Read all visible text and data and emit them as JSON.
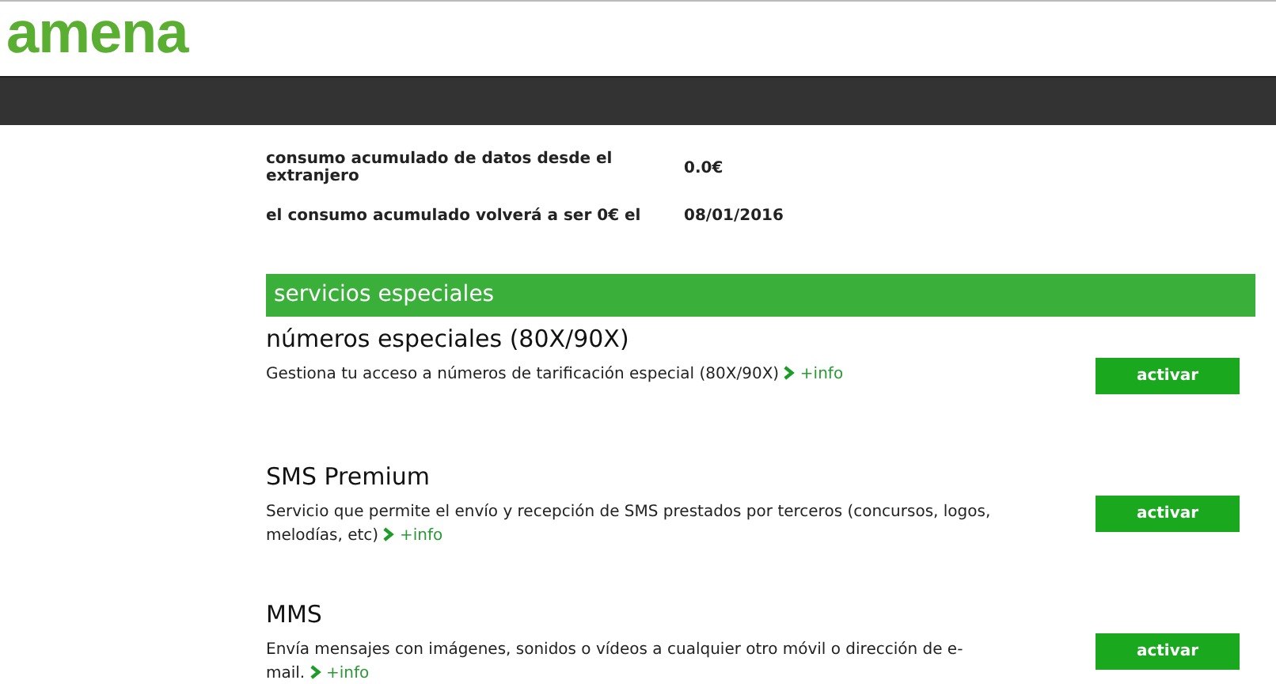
{
  "logo": "amena",
  "summary": [
    {
      "label": "consumo acumulado de datos desde el extranjero",
      "value": "0.0€"
    },
    {
      "label": "el consumo acumulado volverá a ser 0€ el",
      "value": "08/01/2016"
    }
  ],
  "section": {
    "title": "servicios especiales"
  },
  "services": [
    {
      "title": "números especiales (80X/90X)",
      "description": "Gestiona tu acceso a números de tarificación especial (80X/90X)",
      "link": "+info",
      "button": "activar"
    },
    {
      "title": "SMS Premium",
      "description": "Servicio que permite el envío y recepción de SMS prestados por terceros (concursos, logos, melodías, etc)",
      "link": "+info",
      "button": "activar"
    },
    {
      "title": "MMS",
      "description": "Envía mensajes con imágenes, sonidos o vídeos a cualquier otro móvil o dirección de e-mail.",
      "link": "+info",
      "button": "activar"
    }
  ]
}
